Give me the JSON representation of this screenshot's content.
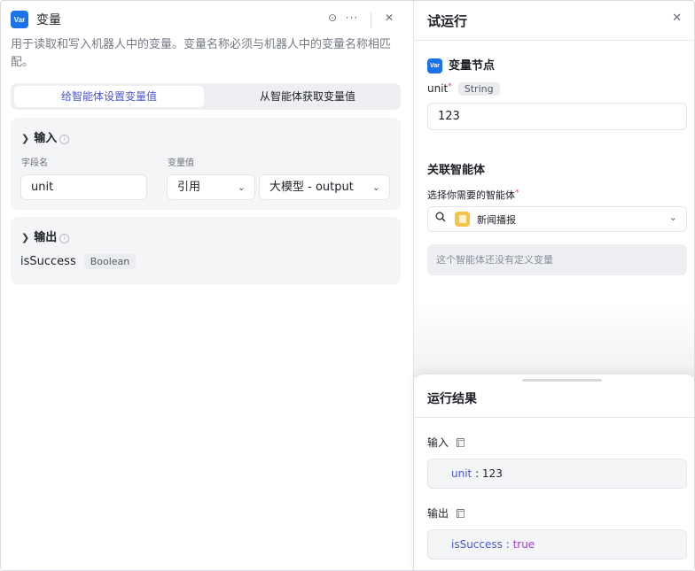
{
  "left_panel": {
    "badge": "Var",
    "title": "变量",
    "description": "用于读取和写入机器人中的变量。变量名称必须与机器人中的变量名称相匹配。",
    "tabs": [
      "给智能体设置变量值",
      "从智能体获取变量值"
    ],
    "active_tab": 0,
    "input_section": {
      "title": "输入",
      "col_field_name": "字段名",
      "col_value": "变量值",
      "field_name": "unit",
      "value_type": "引用",
      "value_source": "大模型 - output"
    },
    "output_section": {
      "title": "输出",
      "var_name": "isSuccess",
      "var_type": "Boolean"
    }
  },
  "right_panel": {
    "title": "试运行",
    "node_badge": "Var",
    "node_title": "变量节点",
    "param_name": "unit",
    "param_required_mark": "*",
    "param_type": "String",
    "param_value": "123",
    "agent_section_title": "关联智能体",
    "agent_select_label": "选择你需要的智能体",
    "agent_select_required": "*",
    "agent_selected": "新闻播报",
    "empty_note": "这个智能体还没有定义变量",
    "results": {
      "title": "运行结果",
      "input_label": "输入",
      "input_key": "unit",
      "input_value": "123",
      "output_label": "输出",
      "output_key": "isSuccess",
      "output_value": "true"
    }
  },
  "icons": {
    "run": "play-circle-icon",
    "more": "more-dots-icon",
    "close": "close-icon",
    "chevron": "chevron-down-icon",
    "info": "info-icon",
    "search": "search-icon",
    "copy": "copy-icon"
  },
  "colors": {
    "accent": "#4b55d1",
    "badge": "#1a73e8",
    "bool_value": "#a23bd1"
  }
}
